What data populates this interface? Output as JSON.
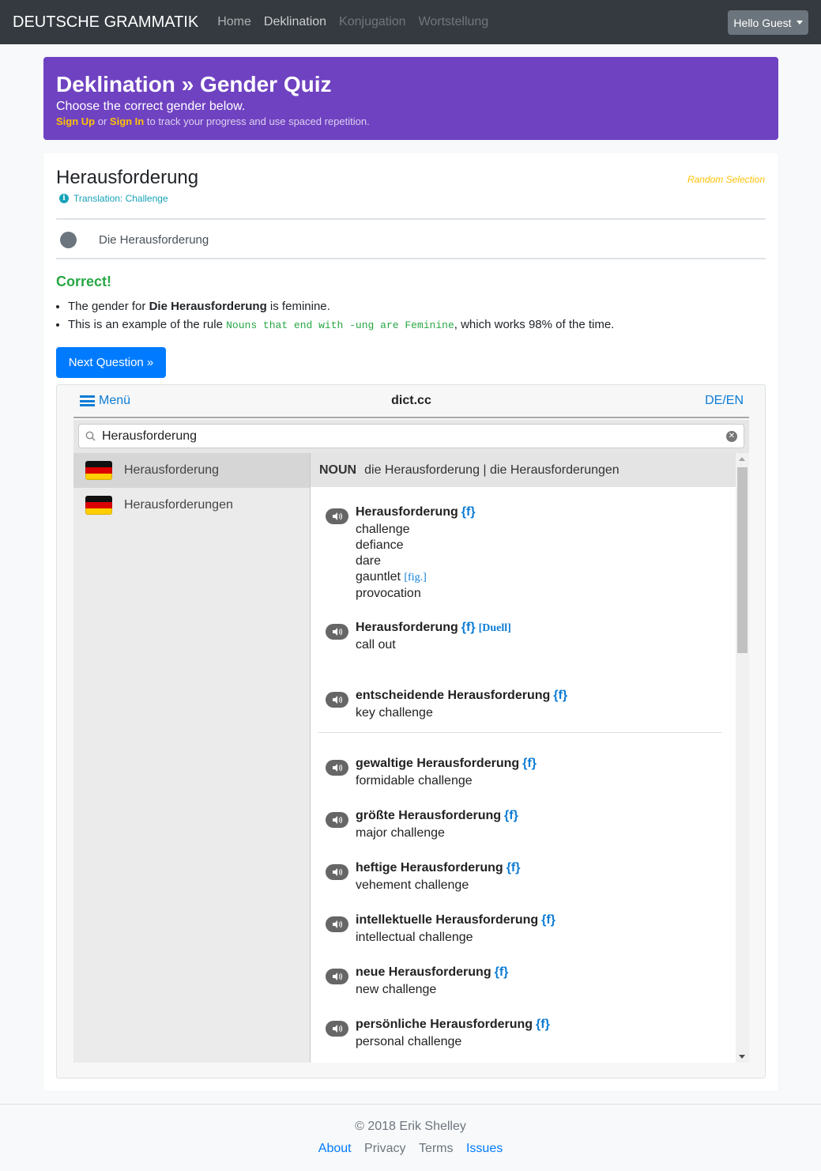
{
  "navbar": {
    "brand": "DEUTSCHE GRAMMATIK",
    "links": [
      "Home",
      "Deklination",
      "Konjugation",
      "Wortstellung"
    ],
    "user_button": "Hello Guest"
  },
  "jumbotron": {
    "title": "Deklination » Gender Quiz",
    "lead": "Choose the correct gender below.",
    "sign_up": "Sign Up",
    "or": " or ",
    "sign_in": "Sign In",
    "tail": " to track your progress and use spaced repetition."
  },
  "quiz": {
    "word": "Herausforderung",
    "random_selection": "Random Selection",
    "translation": "Translation: Challenge",
    "option": "Die Herausforderung",
    "result": "Correct!",
    "b1_pre": "The gender for ",
    "b1_bold": "Die Herausforderung",
    "b1_post": " is feminine.",
    "b2_pre": "This is an example of the rule ",
    "b2_code": "Nouns that end with -ung are Feminine",
    "b2_post": ", which works 98% of the time.",
    "next_button": "Next Question »"
  },
  "dict": {
    "menu": "Menü",
    "title": "dict.cc",
    "lang": "DE/EN",
    "search_value": "Herausforderung",
    "entries": [
      "Herausforderung",
      "Herausforderungen"
    ],
    "noun_label": "NOUN",
    "noun_forms": "die Herausforderung | die Herausforderungen",
    "gender_tag": "{f}",
    "fig_tag": "[fig.]",
    "duell_tag": "[Duell]",
    "senses": [
      {
        "term": "Herausforderung",
        "trans": [
          "challenge",
          "defiance",
          "dare",
          "gauntlet",
          "provocation"
        ]
      },
      {
        "term": "Herausforderung",
        "trans": [
          "call out"
        ]
      },
      {
        "term": "entscheidende Herausforderung",
        "trans": [
          "key challenge"
        ]
      },
      {
        "term": "gewaltige Herausforderung",
        "trans": [
          "formidable challenge"
        ]
      },
      {
        "term": "größte Herausforderung",
        "trans": [
          "major challenge"
        ]
      },
      {
        "term": "heftige Herausforderung",
        "trans": [
          "vehement challenge"
        ]
      },
      {
        "term": "intellektuelle Herausforderung",
        "trans": [
          "intellectual challenge"
        ]
      },
      {
        "term": "neue Herausforderung",
        "trans": [
          "new challenge"
        ]
      },
      {
        "term": "persönliche Herausforderung",
        "trans": [
          "personal challenge"
        ]
      }
    ]
  },
  "footer": {
    "copyright": "© 2018 Erik Shelley",
    "links": [
      "About",
      "Privacy",
      "Terms",
      "Issues"
    ]
  },
  "colors": {
    "navbar": "#343a40",
    "jumbotron": "#6f42c1",
    "primary": "#007bff",
    "success": "#28a745",
    "warning": "#ffc107",
    "info": "#17a2b8"
  }
}
